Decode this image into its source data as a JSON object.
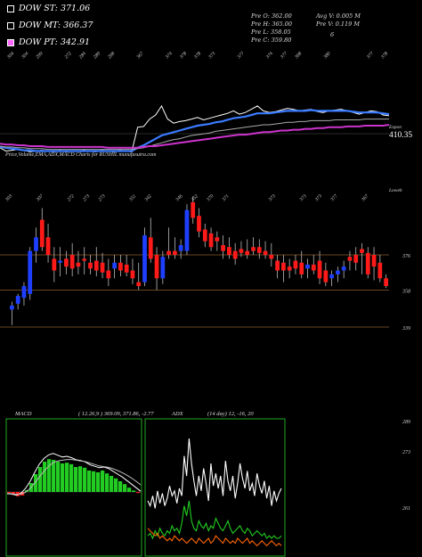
{
  "legend": [
    {
      "label": "DOW ST:",
      "value": "371.06",
      "color": "#000000"
    },
    {
      "label": "DOW MT:",
      "value": "366.37",
      "color": "#000000"
    },
    {
      "label": "DOW PT:",
      "value": "342.91",
      "color": "#ff66ff"
    }
  ],
  "ohlc": {
    "open": "Pre  O: 362.00",
    "high": "Pre  H: 365.00",
    "low": "Pre  L: 358.05",
    "close": "Pre  C: 359.80",
    "avg_volume": "Avg V: 0.005 M",
    "prev_volume": "Pre  V: 0.119 M",
    "marker": "6"
  },
  "colors": {
    "background": "#000000",
    "bull": "#1f3fff",
    "bear": "#ff1a1a",
    "ema_price": "#ffffff",
    "ema_short": "#3a7bff",
    "ema_mid": "#aaaaaa",
    "ema_long": "#cc33cc",
    "macd_hist": "#22cc22",
    "adx_line": "#ffffff",
    "adx_plus": "#22cc22",
    "adx_minus": "#ff6600",
    "panel_border": "#22aa22"
  },
  "chart_data": [
    {
      "type": "line",
      "title": "Price,Volume,EMA,ADX,MACD Charts for RUSHIL munafasutra.com",
      "top_value_labels": [
        "304",
        "304",
        "299",
        "",
        "272",
        "284",
        "289",
        "298",
        "",
        "367",
        "",
        "374",
        "378",
        "378",
        "373",
        "",
        "377",
        "",
        "374",
        "377",
        "398",
        "",
        "380",
        "",
        "",
        "377",
        "378"
      ],
      "right_label": "410.35",
      "corner_label": "Expon",
      "series": [
        {
          "values": [
            305,
            301,
            302,
            303,
            302,
            300,
            301,
            302,
            301,
            300,
            302,
            300,
            301,
            301,
            302,
            301,
            300,
            302,
            301,
            300,
            302,
            301,
            300,
            330,
            331,
            340,
            345,
            356,
            340,
            335,
            337,
            338,
            340,
            342,
            339,
            341,
            343,
            345,
            347,
            350,
            346,
            348,
            352,
            356,
            350,
            348,
            349,
            351,
            353,
            352,
            350,
            351,
            352,
            349,
            348,
            350,
            351,
            352,
            350,
            348,
            346,
            348,
            350,
            349,
            345,
            344
          ]
        },
        {
          "values": [
            306,
            305,
            304,
            303,
            302,
            302,
            301,
            301,
            301,
            301,
            301,
            301,
            301,
            301,
            301,
            301,
            301,
            301,
            301,
            301,
            301,
            301,
            301,
            305,
            308,
            312,
            316,
            320,
            322,
            324,
            326,
            328,
            330,
            332,
            333,
            334,
            336,
            337,
            339,
            341,
            342,
            343,
            345,
            347,
            347,
            347,
            348,
            349,
            350,
            350,
            350,
            350,
            351,
            350,
            350,
            350,
            350,
            350,
            350,
            349,
            348,
            348,
            348,
            348,
            347,
            346
          ]
        },
        {
          "values": [
            307,
            306,
            306,
            305,
            305,
            304,
            304,
            304,
            303,
            303,
            303,
            303,
            303,
            303,
            303,
            303,
            303,
            303,
            303,
            303,
            303,
            303,
            303,
            304,
            305,
            307,
            309,
            311,
            313,
            315,
            316,
            318,
            320,
            321,
            322,
            323,
            325,
            326,
            327,
            328,
            329,
            330,
            331,
            332,
            333,
            333,
            334,
            335,
            336,
            336,
            337,
            337,
            338,
            338,
            338,
            338,
            339,
            339,
            339,
            339,
            339,
            340,
            340,
            340,
            340,
            340
          ]
        },
        {
          "values": [
            310,
            309,
            309,
            308,
            308,
            307,
            307,
            307,
            306,
            306,
            306,
            306,
            306,
            306,
            306,
            306,
            306,
            306,
            305,
            305,
            305,
            305,
            305,
            305,
            306,
            307,
            307,
            308,
            309,
            310,
            311,
            312,
            313,
            314,
            315,
            316,
            317,
            318,
            319,
            320,
            321,
            321,
            322,
            323,
            324,
            324,
            325,
            326,
            326,
            327,
            327,
            328,
            328,
            329,
            329,
            330,
            330,
            330,
            331,
            331,
            331,
            332,
            332,
            332,
            332,
            333
          ]
        }
      ]
    },
    {
      "type": "bar",
      "title": "",
      "top_value_labels": [
        "303",
        "",
        "307",
        "",
        "272",
        "273",
        "273",
        "",
        "351",
        "342",
        "",
        "346",
        "352",
        "370",
        "371",
        "",
        "",
        "373",
        "",
        "373",
        "373",
        "377",
        "",
        "367"
      ],
      "corner_label": "Loweb",
      "y_tick_labels": [
        "376",
        "358",
        "339"
      ],
      "hlines": [
        376,
        358,
        339
      ],
      "candles": [
        {
          "o": 348,
          "h": 352,
          "l": 340,
          "c": 350
        },
        {
          "o": 351,
          "h": 356,
          "l": 348,
          "c": 355
        },
        {
          "o": 354,
          "h": 362,
          "l": 350,
          "c": 360
        },
        {
          "o": 356,
          "h": 380,
          "l": 353,
          "c": 378
        },
        {
          "o": 378,
          "h": 390,
          "l": 372,
          "c": 385
        },
        {
          "o": 394,
          "h": 400,
          "l": 378,
          "c": 380
        },
        {
          "o": 385,
          "h": 392,
          "l": 372,
          "c": 376
        },
        {
          "o": 374,
          "h": 380,
          "l": 362,
          "c": 368
        },
        {
          "o": 372,
          "h": 380,
          "l": 365,
          "c": 373
        },
        {
          "o": 374,
          "h": 378,
          "l": 366,
          "c": 370
        },
        {
          "o": 376,
          "h": 382,
          "l": 365,
          "c": 369
        },
        {
          "o": 372,
          "h": 378,
          "l": 366,
          "c": 370
        },
        {
          "o": 374,
          "h": 380,
          "l": 366,
          "c": 373
        },
        {
          "o": 372,
          "h": 376,
          "l": 366,
          "c": 369
        },
        {
          "o": 373,
          "h": 380,
          "l": 365,
          "c": 368
        },
        {
          "o": 372,
          "h": 377,
          "l": 364,
          "c": 367
        },
        {
          "o": 368,
          "h": 374,
          "l": 360,
          "c": 364
        },
        {
          "o": 369,
          "h": 376,
          "l": 364,
          "c": 372
        },
        {
          "o": 372,
          "h": 376,
          "l": 365,
          "c": 368
        },
        {
          "o": 371,
          "h": 376,
          "l": 365,
          "c": 367
        },
        {
          "o": 368,
          "h": 374,
          "l": 361,
          "c": 364
        },
        {
          "o": 362,
          "h": 372,
          "l": 358,
          "c": 360
        },
        {
          "o": 362,
          "h": 390,
          "l": 360,
          "c": 386
        },
        {
          "o": 385,
          "h": 395,
          "l": 372,
          "c": 374
        },
        {
          "o": 376,
          "h": 380,
          "l": 358,
          "c": 364
        },
        {
          "o": 364,
          "h": 378,
          "l": 361,
          "c": 375
        },
        {
          "o": 378,
          "h": 390,
          "l": 374,
          "c": 376
        },
        {
          "o": 378,
          "h": 385,
          "l": 374,
          "c": 376
        },
        {
          "o": 378,
          "h": 384,
          "l": 374,
          "c": 381
        },
        {
          "o": 378,
          "h": 402,
          "l": 376,
          "c": 399
        },
        {
          "o": 403,
          "h": 406,
          "l": 392,
          "c": 395
        },
        {
          "o": 396,
          "h": 400,
          "l": 385,
          "c": 388
        },
        {
          "o": 389,
          "h": 392,
          "l": 380,
          "c": 383
        },
        {
          "o": 387,
          "h": 390,
          "l": 378,
          "c": 380
        },
        {
          "o": 385,
          "h": 388,
          "l": 378,
          "c": 383
        },
        {
          "o": 381,
          "h": 386,
          "l": 374,
          "c": 378
        },
        {
          "o": 380,
          "h": 385,
          "l": 374,
          "c": 376
        },
        {
          "o": 378,
          "h": 382,
          "l": 371,
          "c": 374
        },
        {
          "o": 379,
          "h": 383,
          "l": 375,
          "c": 377
        },
        {
          "o": 378,
          "h": 384,
          "l": 374,
          "c": 376
        },
        {
          "o": 380,
          "h": 385,
          "l": 376,
          "c": 378
        },
        {
          "o": 380,
          "h": 384,
          "l": 374,
          "c": 377
        },
        {
          "o": 378,
          "h": 383,
          "l": 374,
          "c": 376
        },
        {
          "o": 376,
          "h": 382,
          "l": 370,
          "c": 374
        },
        {
          "o": 373,
          "h": 376,
          "l": 364,
          "c": 368
        },
        {
          "o": 372,
          "h": 376,
          "l": 362,
          "c": 368
        },
        {
          "o": 370,
          "h": 374,
          "l": 364,
          "c": 368
        },
        {
          "o": 373,
          "h": 376,
          "l": 366,
          "c": 369
        },
        {
          "o": 372,
          "h": 378,
          "l": 364,
          "c": 366
        },
        {
          "o": 369,
          "h": 374,
          "l": 364,
          "c": 371
        },
        {
          "o": 371,
          "h": 376,
          "l": 366,
          "c": 368
        },
        {
          "o": 373,
          "h": 378,
          "l": 361,
          "c": 364
        },
        {
          "o": 368,
          "h": 372,
          "l": 360,
          "c": 362
        },
        {
          "o": 364,
          "h": 368,
          "l": 360,
          "c": 366
        },
        {
          "o": 366,
          "h": 370,
          "l": 362,
          "c": 368
        },
        {
          "o": 368,
          "h": 373,
          "l": 364,
          "c": 370
        },
        {
          "o": 375,
          "h": 378,
          "l": 368,
          "c": 373
        },
        {
          "o": 376,
          "h": 380,
          "l": 368,
          "c": 372
        },
        {
          "o": 379,
          "h": 382,
          "l": 366,
          "c": 377
        },
        {
          "o": 377,
          "h": 380,
          "l": 364,
          "c": 366
        },
        {
          "o": 376,
          "h": 380,
          "l": 363,
          "c": 370
        },
        {
          "o": 372,
          "h": 376,
          "l": 362,
          "c": 364
        },
        {
          "o": 364,
          "h": 366,
          "l": 359,
          "c": 360
        }
      ]
    },
    {
      "type": "area",
      "title": "MACD",
      "stats": "( 12.26,9 ) 369.09, 371.86, -2.77",
      "y_tick_labels": [
        "289",
        "273",
        "261"
      ],
      "series": [
        {
          "values": [
            -0.3,
            -0.8,
            -1.2,
            -1.0,
            0.5,
            2.5,
            5.0,
            7.0,
            8.5,
            9.2,
            9.0,
            8.5,
            8.0,
            8.2,
            7.8,
            7.0,
            7.2,
            6.8,
            6.0,
            5.8,
            5.5,
            6.0,
            5.2,
            4.5,
            3.8,
            3.0,
            2.2,
            1.2,
            0.4,
            -0.3
          ]
        },
        {
          "values": [
            -0.5,
            -0.6,
            -0.9,
            -0.4,
            1.0,
            3.0,
            5.5,
            7.8,
            9.4,
            10.4,
            10.8,
            10.3,
            9.8,
            10.0,
            9.6,
            9.0,
            8.8,
            8.4,
            7.6,
            7.2,
            6.8,
            7.0,
            6.6,
            5.8,
            5.0,
            4.2,
            3.2,
            2.2,
            1.2,
            0.2
          ]
        },
        {
          "values": [
            -0.4,
            -0.5,
            -0.7,
            -0.6,
            -0.1,
            1.0,
            2.5,
            4.2,
            5.8,
            7.2,
            8.2,
            8.7,
            8.9,
            9.1,
            9.1,
            8.9,
            8.7,
            8.5,
            8.1,
            7.7,
            7.3,
            7.1,
            6.9,
            6.5,
            6.0,
            5.4,
            4.7,
            3.9,
            3.0,
            2.0
          ]
        }
      ]
    },
    {
      "type": "line",
      "title": "ADX",
      "stats": "(14 day) 12, -16, 20",
      "series": [
        {
          "values": [
            20,
            18,
            22,
            17,
            24,
            19,
            23,
            18,
            21,
            26,
            22,
            24,
            19,
            25,
            22,
            38,
            30,
            45,
            35,
            28,
            22,
            30,
            24,
            33,
            27,
            20,
            35,
            26,
            31,
            25,
            30,
            22,
            36,
            28,
            24,
            30,
            21,
            27,
            35,
            29,
            25,
            32,
            24,
            27,
            22,
            31,
            26,
            23,
            28,
            21,
            26,
            18,
            24,
            20,
            23,
            25
          ]
        },
        {
          "values": [
            6,
            7,
            5,
            8,
            6,
            9,
            7,
            6,
            8,
            7,
            10,
            8,
            9,
            7,
            11,
            18,
            14,
            20,
            12,
            9,
            8,
            12,
            10,
            9,
            11,
            8,
            10,
            9,
            13,
            11,
            9,
            8,
            10,
            12,
            9,
            7,
            8,
            9,
            10,
            8,
            7,
            9,
            8,
            6,
            7,
            8,
            7,
            6,
            7,
            5,
            6,
            5,
            6,
            5,
            5,
            6
          ]
        },
        {
          "values": [
            9,
            8,
            7,
            6,
            7,
            5,
            6,
            5,
            4,
            5,
            4,
            6,
            5,
            4,
            5,
            4,
            3,
            4,
            5,
            4,
            3,
            5,
            4,
            3,
            4,
            5,
            3,
            4,
            6,
            5,
            4,
            3,
            5,
            4,
            3,
            4,
            3,
            5,
            4,
            3,
            4,
            5,
            3,
            4,
            3,
            2,
            3,
            4,
            3,
            2,
            3,
            4,
            3,
            2,
            3,
            2
          ]
        }
      ]
    }
  ]
}
